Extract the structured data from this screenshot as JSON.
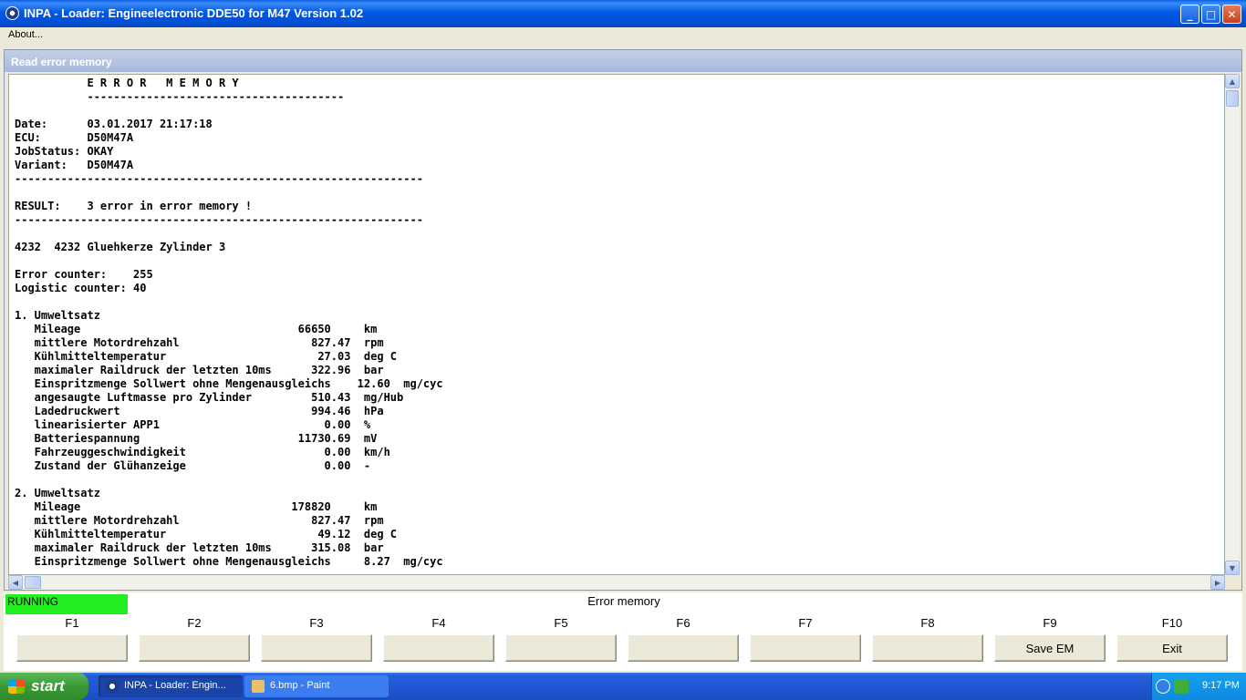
{
  "window": {
    "title": "INPA - Loader:  Engineelectronic DDE50 for M47 Version 1.02"
  },
  "menu": {
    "about": "About..."
  },
  "child_window": {
    "title": "Read error memory"
  },
  "log_lines": [
    "           E R R O R   M E M O R Y",
    "           ---------------------------------------",
    "",
    "Date:      03.01.2017 21:17:18",
    "ECU:       D50M47A",
    "JobStatus: OKAY",
    "Variant:   D50M47A",
    "--------------------------------------------------------------",
    "",
    "RESULT:    3 error in error memory !",
    "--------------------------------------------------------------",
    "",
    "4232  4232 Gluehkerze Zylinder 3",
    "",
    "Error counter:    255",
    "Logistic counter: 40",
    "",
    "1. Umweltsatz",
    "   Mileage                                 66650     km",
    "   mittlere Motordrehzahl                    827.47  rpm",
    "   Kühlmitteltemperatur                       27.03  deg C",
    "   maximaler Raildruck der letzten 10ms      322.96  bar",
    "   Einspritzmenge Sollwert ohne Mengenausgleichs    12.60  mg/cyc",
    "   angesaugte Luftmasse pro Zylinder         510.43  mg/Hub",
    "   Ladedruckwert                             994.46  hPa",
    "   linearisierter APP1                         0.00  %",
    "   Batteriespannung                        11730.69  mV",
    "   Fahrzeuggeschwindigkeit                     0.00  km/h",
    "   Zustand der Glühanzeige                     0.00  -",
    "",
    "2. Umweltsatz",
    "   Mileage                                178820     km",
    "   mittlere Motordrehzahl                    827.47  rpm",
    "   Kühlmitteltemperatur                       49.12  deg C",
    "   maximaler Raildruck der letzten 10ms      315.08  bar",
    "   Einspritzmenge Sollwert ohne Mengenausgleichs     8.27  mg/cyc"
  ],
  "status": {
    "state": "RUNNING",
    "mode": "Error memory"
  },
  "fkeys": [
    {
      "key": "F1",
      "label": ""
    },
    {
      "key": "F2",
      "label": ""
    },
    {
      "key": "F3",
      "label": ""
    },
    {
      "key": "F4",
      "label": ""
    },
    {
      "key": "F5",
      "label": ""
    },
    {
      "key": "F6",
      "label": ""
    },
    {
      "key": "F7",
      "label": ""
    },
    {
      "key": "F8",
      "label": ""
    },
    {
      "key": "F9",
      "label": "Save EM"
    },
    {
      "key": "F10",
      "label": "Exit"
    }
  ],
  "taskbar": {
    "start": "start",
    "tasks": [
      {
        "label": "INPA - Loader: Engin...",
        "active": true
      },
      {
        "label": "6.bmp - Paint",
        "active": false
      }
    ],
    "clock": "9:17 PM"
  },
  "colors": {
    "running": "#22ee22",
    "titlebar": "#0058e6",
    "taskbar": "#245edb"
  }
}
